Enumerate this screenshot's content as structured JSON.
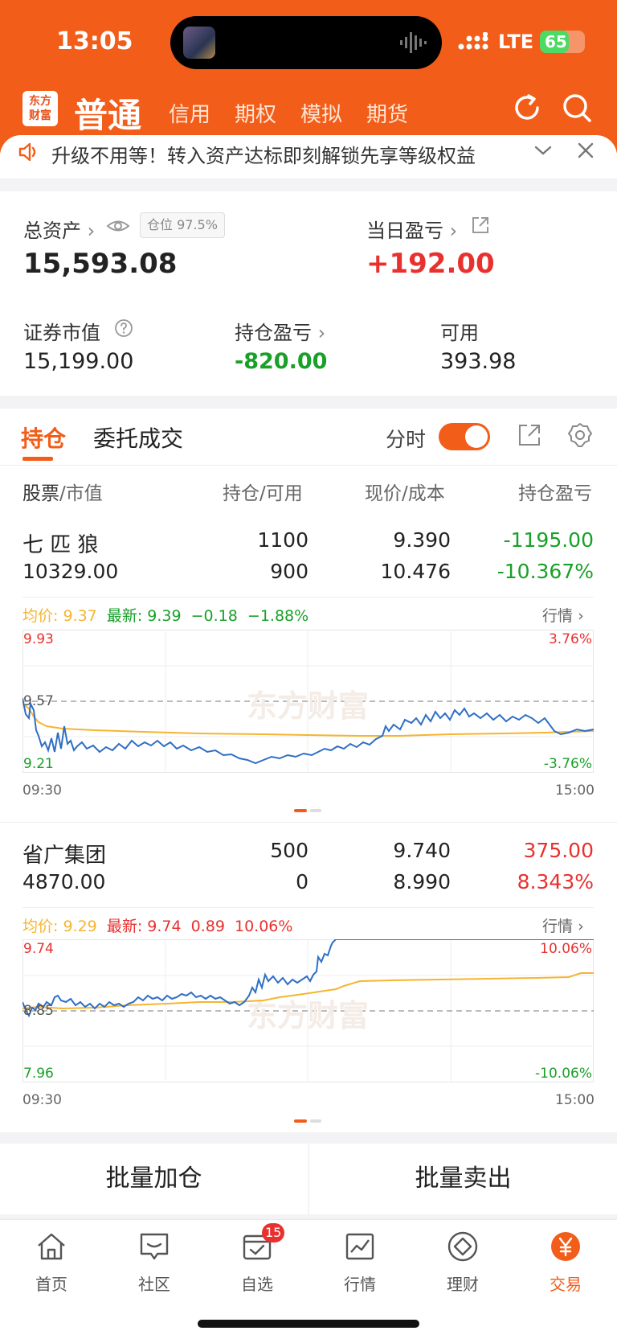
{
  "status_bar": {
    "time": "13:05",
    "network": "LTE",
    "battery": "65",
    "battery_level": 0.65
  },
  "header": {
    "logo_text": [
      "东方",
      "财富"
    ],
    "active_tab": "普通",
    "tabs": [
      "信用",
      "期权",
      "模拟",
      "期货"
    ],
    "icons": [
      "refresh-icon",
      "search-icon"
    ]
  },
  "notice": {
    "text": "升级不用等！转入资产达标即刻解锁先享等级权益"
  },
  "summary": {
    "total_assets_label": "总资产",
    "position_ratio": "仓位 97.5%",
    "total_assets": "15,593.08",
    "daily_pnl_label": "当日盈亏",
    "daily_pnl": "+192.00",
    "market_value_label": "证券市值",
    "market_value": "15,199.00",
    "position_pnl_label": "持仓盈亏",
    "position_pnl": "-820.00",
    "available_label": "可用",
    "available": "393.98"
  },
  "positions_tabs": {
    "tabs": [
      "持仓",
      "委托成交"
    ],
    "intraday_label": "分时",
    "intraday_on": true
  },
  "table_header": {
    "stock": "股票",
    "market_value": "/市值",
    "holding": "持仓",
    "available": "/可用",
    "price": "现价",
    "cost": "/成本",
    "pnl": "持仓盈亏"
  },
  "colors": {
    "accent": "#f25d19",
    "up": "#e8312f",
    "down": "#18a028",
    "avg_line": "#f5b530",
    "price_line": "#2f6fc4"
  },
  "stocks": [
    {
      "name": "七 匹 狼",
      "market_value": "10329.00",
      "holding": "1100",
      "available": "900",
      "price": "9.390",
      "cost": "10.476",
      "pnl": "-1195.00",
      "pnl_pct": "-10.367%",
      "avg_label": "均价:",
      "avg": "9.37",
      "latest_label": "最新:",
      "latest": "9.39",
      "change": "−0.18",
      "change_pct": "−1.88%",
      "quote_link": "行情",
      "axis_high": "9.93",
      "axis_mid": "9.57",
      "axis_low": "9.21",
      "pct_high": "3.76%",
      "pct_low": "-3.76%",
      "time_start": "09:30",
      "time_end": "15:00",
      "watermark": "东方财富"
    },
    {
      "name": "省广集团",
      "market_value": "4870.00",
      "holding": "500",
      "available": "0",
      "price": "9.740",
      "cost": "8.990",
      "pnl": "375.00",
      "pnl_pct": "8.343%",
      "avg_label": "均价:",
      "avg": "9.29",
      "latest_label": "最新:",
      "latest": "9.74",
      "change": "0.89",
      "change_pct": "10.06%",
      "quote_link": "行情",
      "axis_high": "9.74",
      "axis_mid": "8.85",
      "axis_low": "7.96",
      "pct_high": "10.06%",
      "pct_low": "-10.06%",
      "time_start": "09:30",
      "time_end": "15:00",
      "watermark": "东方财富"
    }
  ],
  "actions": {
    "batch_add": "批量加仓",
    "batch_sell": "批量卖出"
  },
  "tabbar": {
    "items": [
      {
        "label": "首页",
        "icon": "home-icon"
      },
      {
        "label": "社区",
        "icon": "chat-icon"
      },
      {
        "label": "自选",
        "icon": "checklist-icon",
        "badge": "15"
      },
      {
        "label": "行情",
        "icon": "chart-icon"
      },
      {
        "label": "理财",
        "icon": "diamond-icon"
      },
      {
        "label": "交易",
        "icon": "yuan-icon"
      }
    ]
  }
}
